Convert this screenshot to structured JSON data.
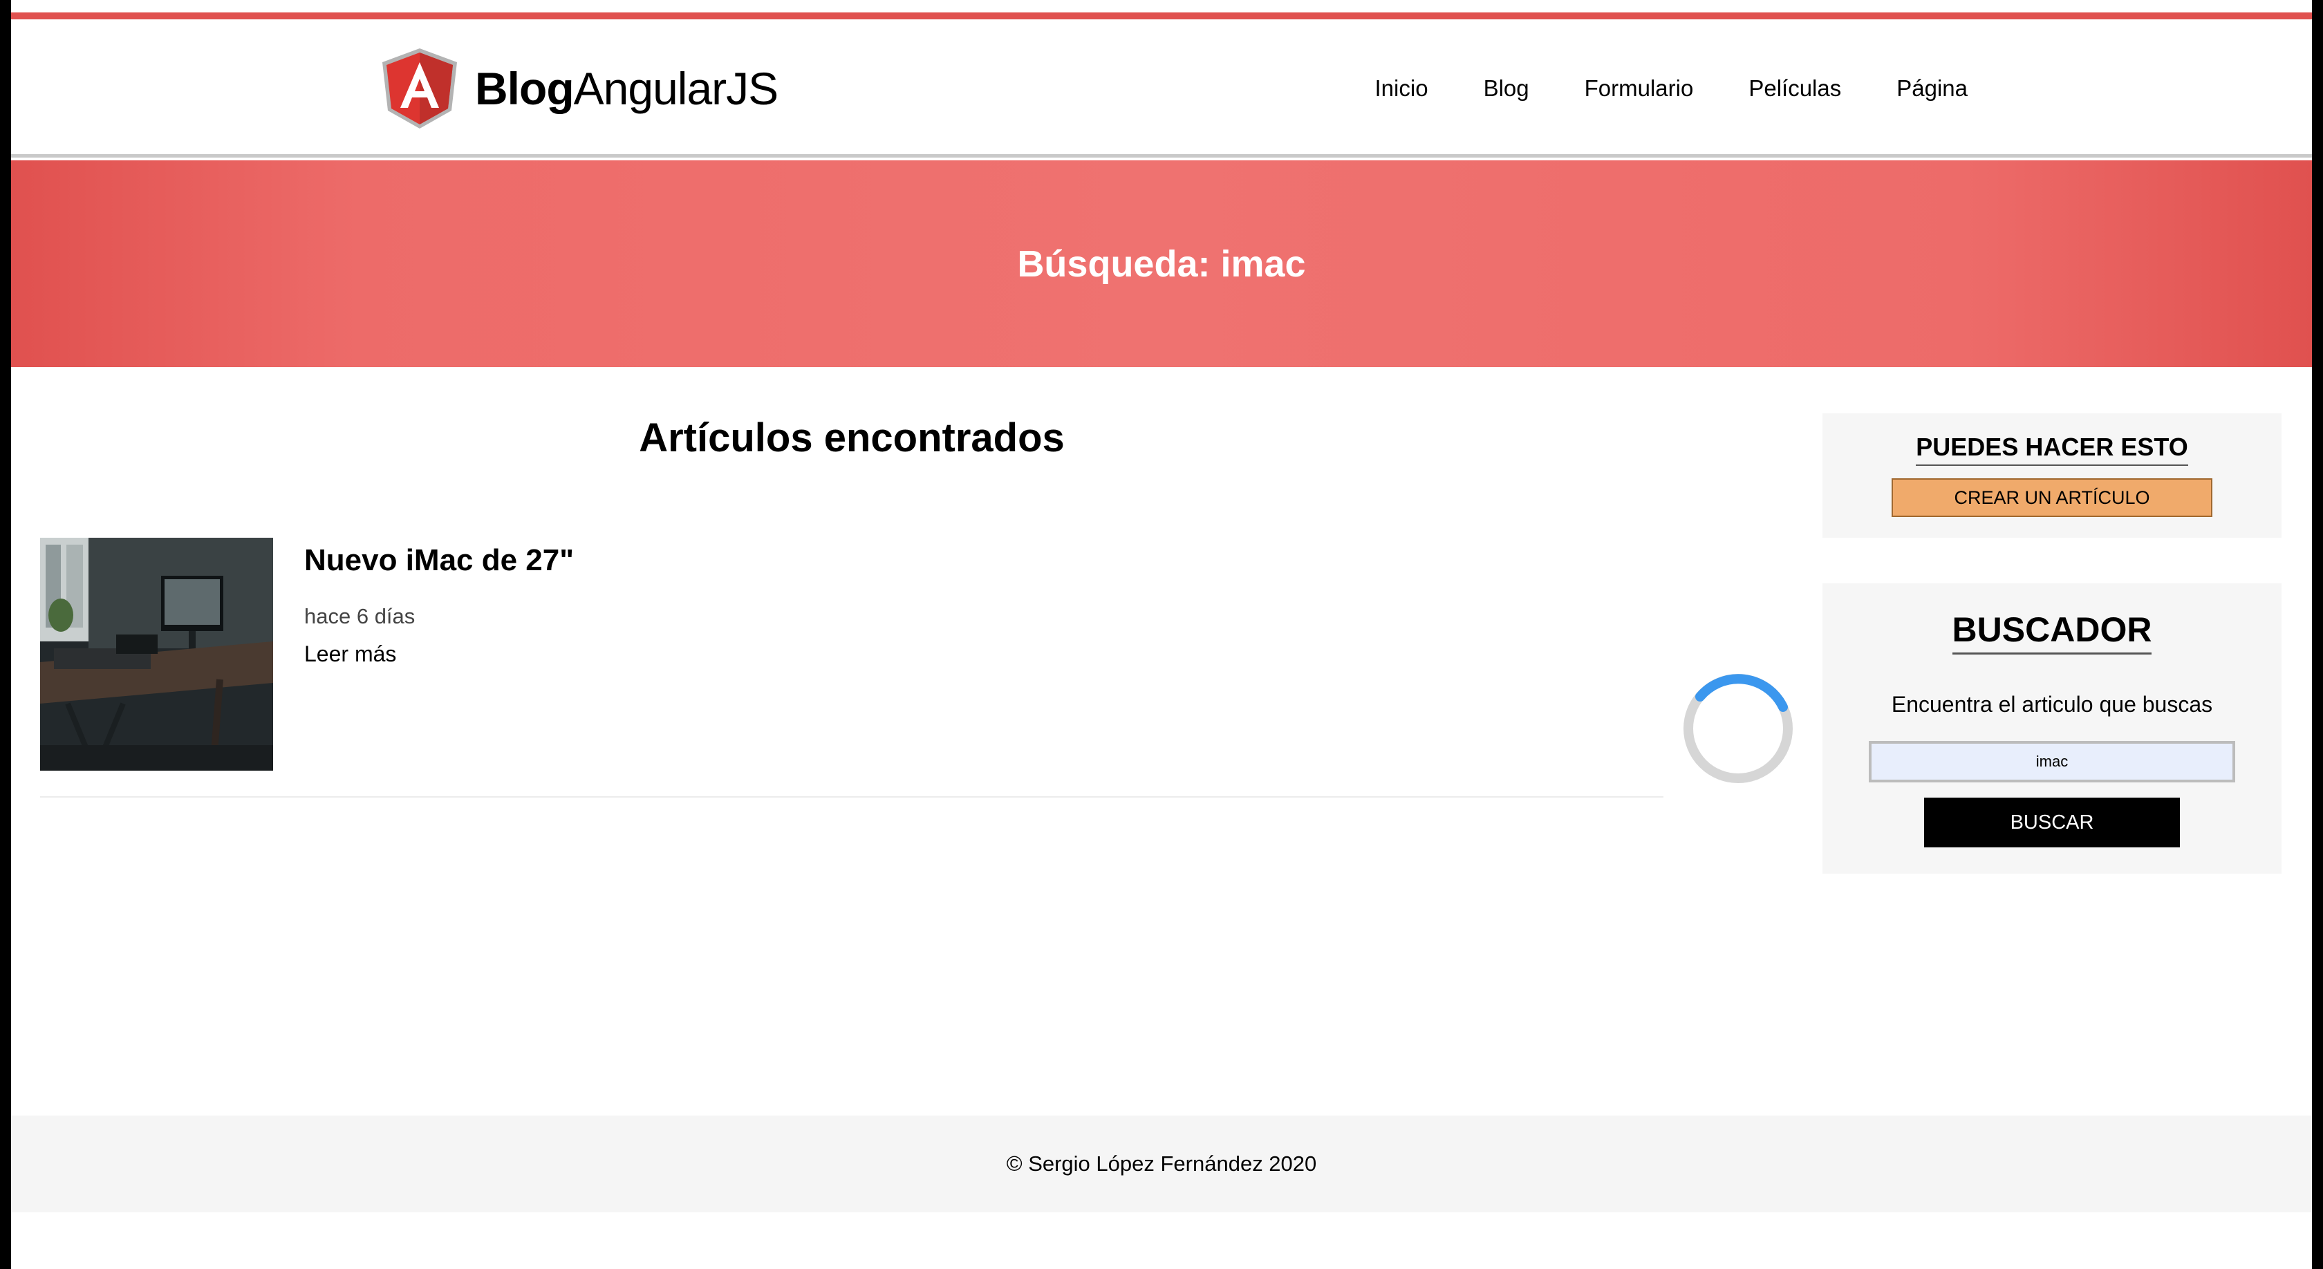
{
  "header": {
    "logo_bold": "Blog",
    "logo_regular": "AngularJS",
    "logo_icon": "angular-shield-icon",
    "nav": [
      {
        "label": "Inicio"
      },
      {
        "label": "Blog"
      },
      {
        "label": "Formulario"
      },
      {
        "label": "Películas"
      },
      {
        "label": "Página"
      }
    ]
  },
  "banner": {
    "title": "Búsqueda: imac"
  },
  "main": {
    "heading": "Artículos encontrados",
    "articles": [
      {
        "title": "Nuevo iMac de 27\"",
        "date": "hace 6 días",
        "link": "Leer más"
      }
    ]
  },
  "sidebar": {
    "actions_title": "PUEDES HACER ESTO",
    "create_button": "CREAR UN ARTÍCULO",
    "search_title": "BUSCADOR",
    "search_text": "Encuentra el articulo que buscas",
    "search_value": "imac",
    "search_button": "BUSCAR"
  },
  "footer": {
    "copyright": "© Sergio López Fernández 2020"
  },
  "colors": {
    "accent": "#e0514f",
    "banner_light": "#ef7270",
    "create_button": "#f0aa6b",
    "spinner": "#3b97ee",
    "sidebar_bg": "#f6f6f6"
  }
}
